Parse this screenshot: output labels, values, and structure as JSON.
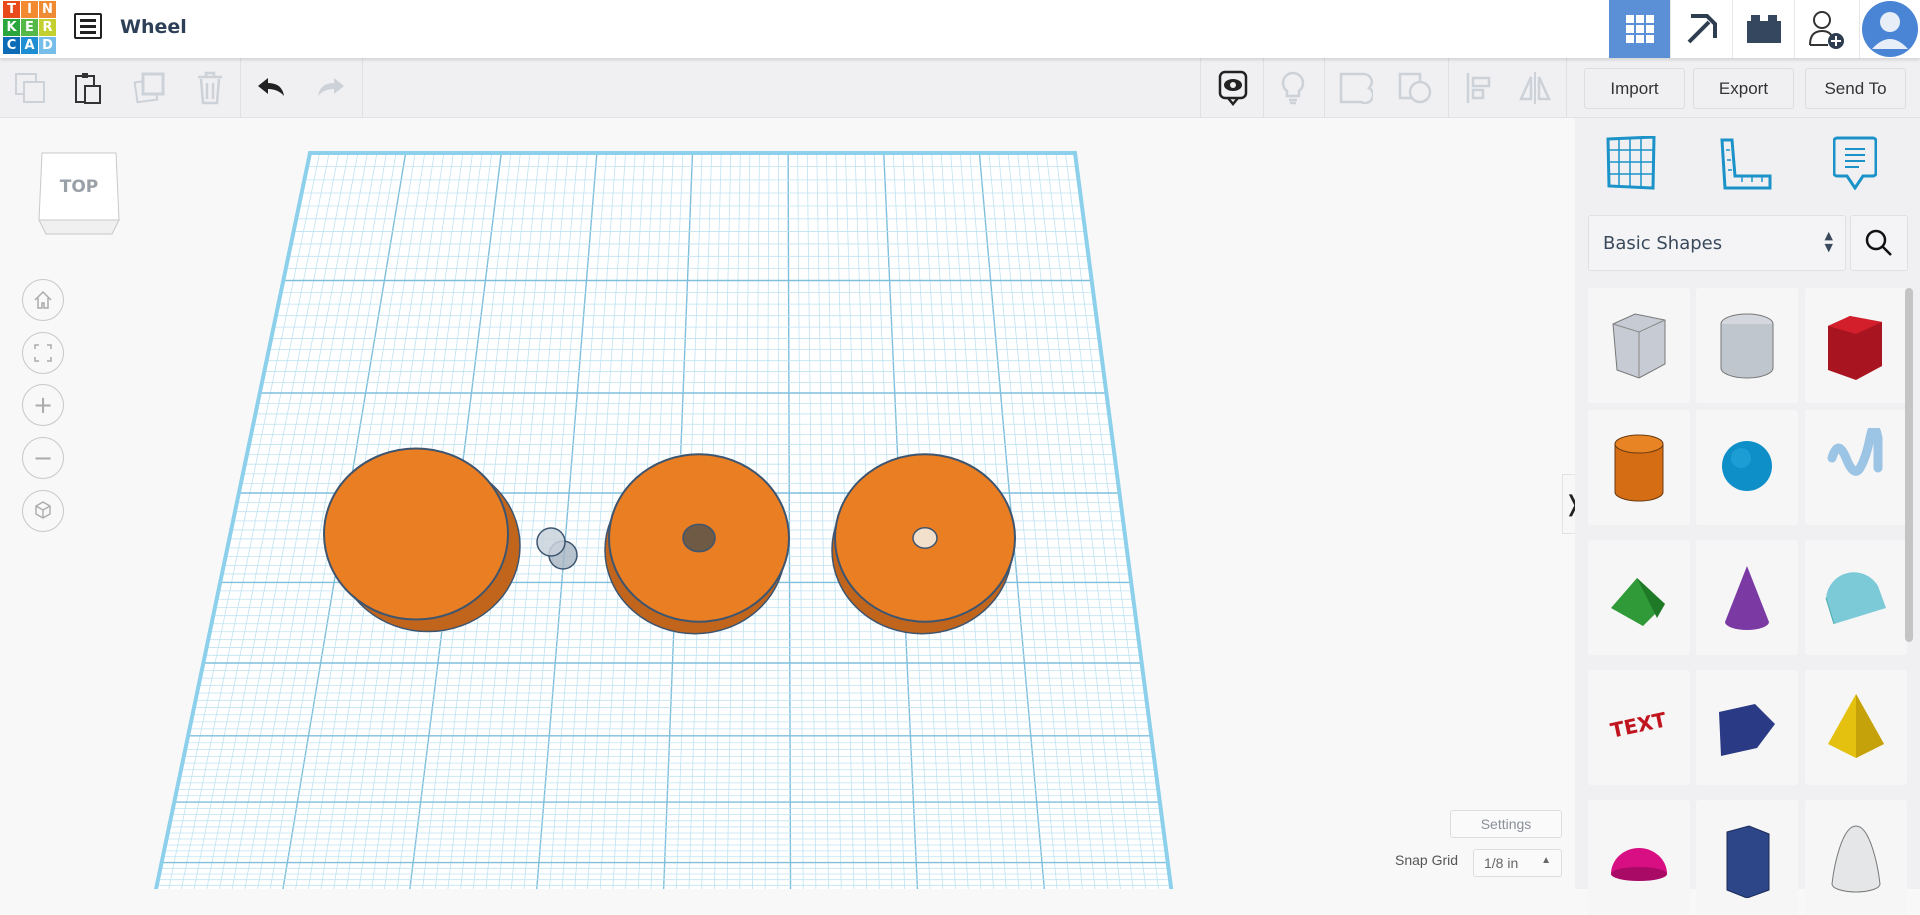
{
  "app": {
    "logo_letters": [
      "T",
      "I",
      "N",
      "K",
      "E",
      "R",
      "C",
      "A",
      "D"
    ],
    "logo_colors": [
      "#e84a1b",
      "#f48a30",
      "#ef8b32",
      "#2aa63c",
      "#54b947",
      "#c4d02f",
      "#0d6cb5",
      "#1f8fd4",
      "#76bde9"
    ],
    "design_title": "Wheel"
  },
  "header": {
    "icons": [
      "grid-view-icon",
      "pickaxe-icon",
      "brick-icon",
      "add-user-icon",
      "avatar"
    ],
    "accent": "#5b8fd6"
  },
  "toolbar": {
    "import": "Import",
    "export": "Export",
    "send_to": "Send To"
  },
  "viewcube": {
    "label": "TOP"
  },
  "panel": {
    "category": "Basic Shapes",
    "shapes": [
      "Box Hole",
      "Cylinder Hole",
      "Box",
      "Cylinder",
      "Sphere",
      "Scribble",
      "Roof",
      "Cone",
      "Round Roof",
      "Text",
      "Wedge",
      "Pyramid",
      "Half Sphere",
      "Polygon",
      "Paraboloid"
    ]
  },
  "footer": {
    "settings": "Settings",
    "snap_label": "Snap Grid",
    "snap_value": "1/8 in"
  }
}
